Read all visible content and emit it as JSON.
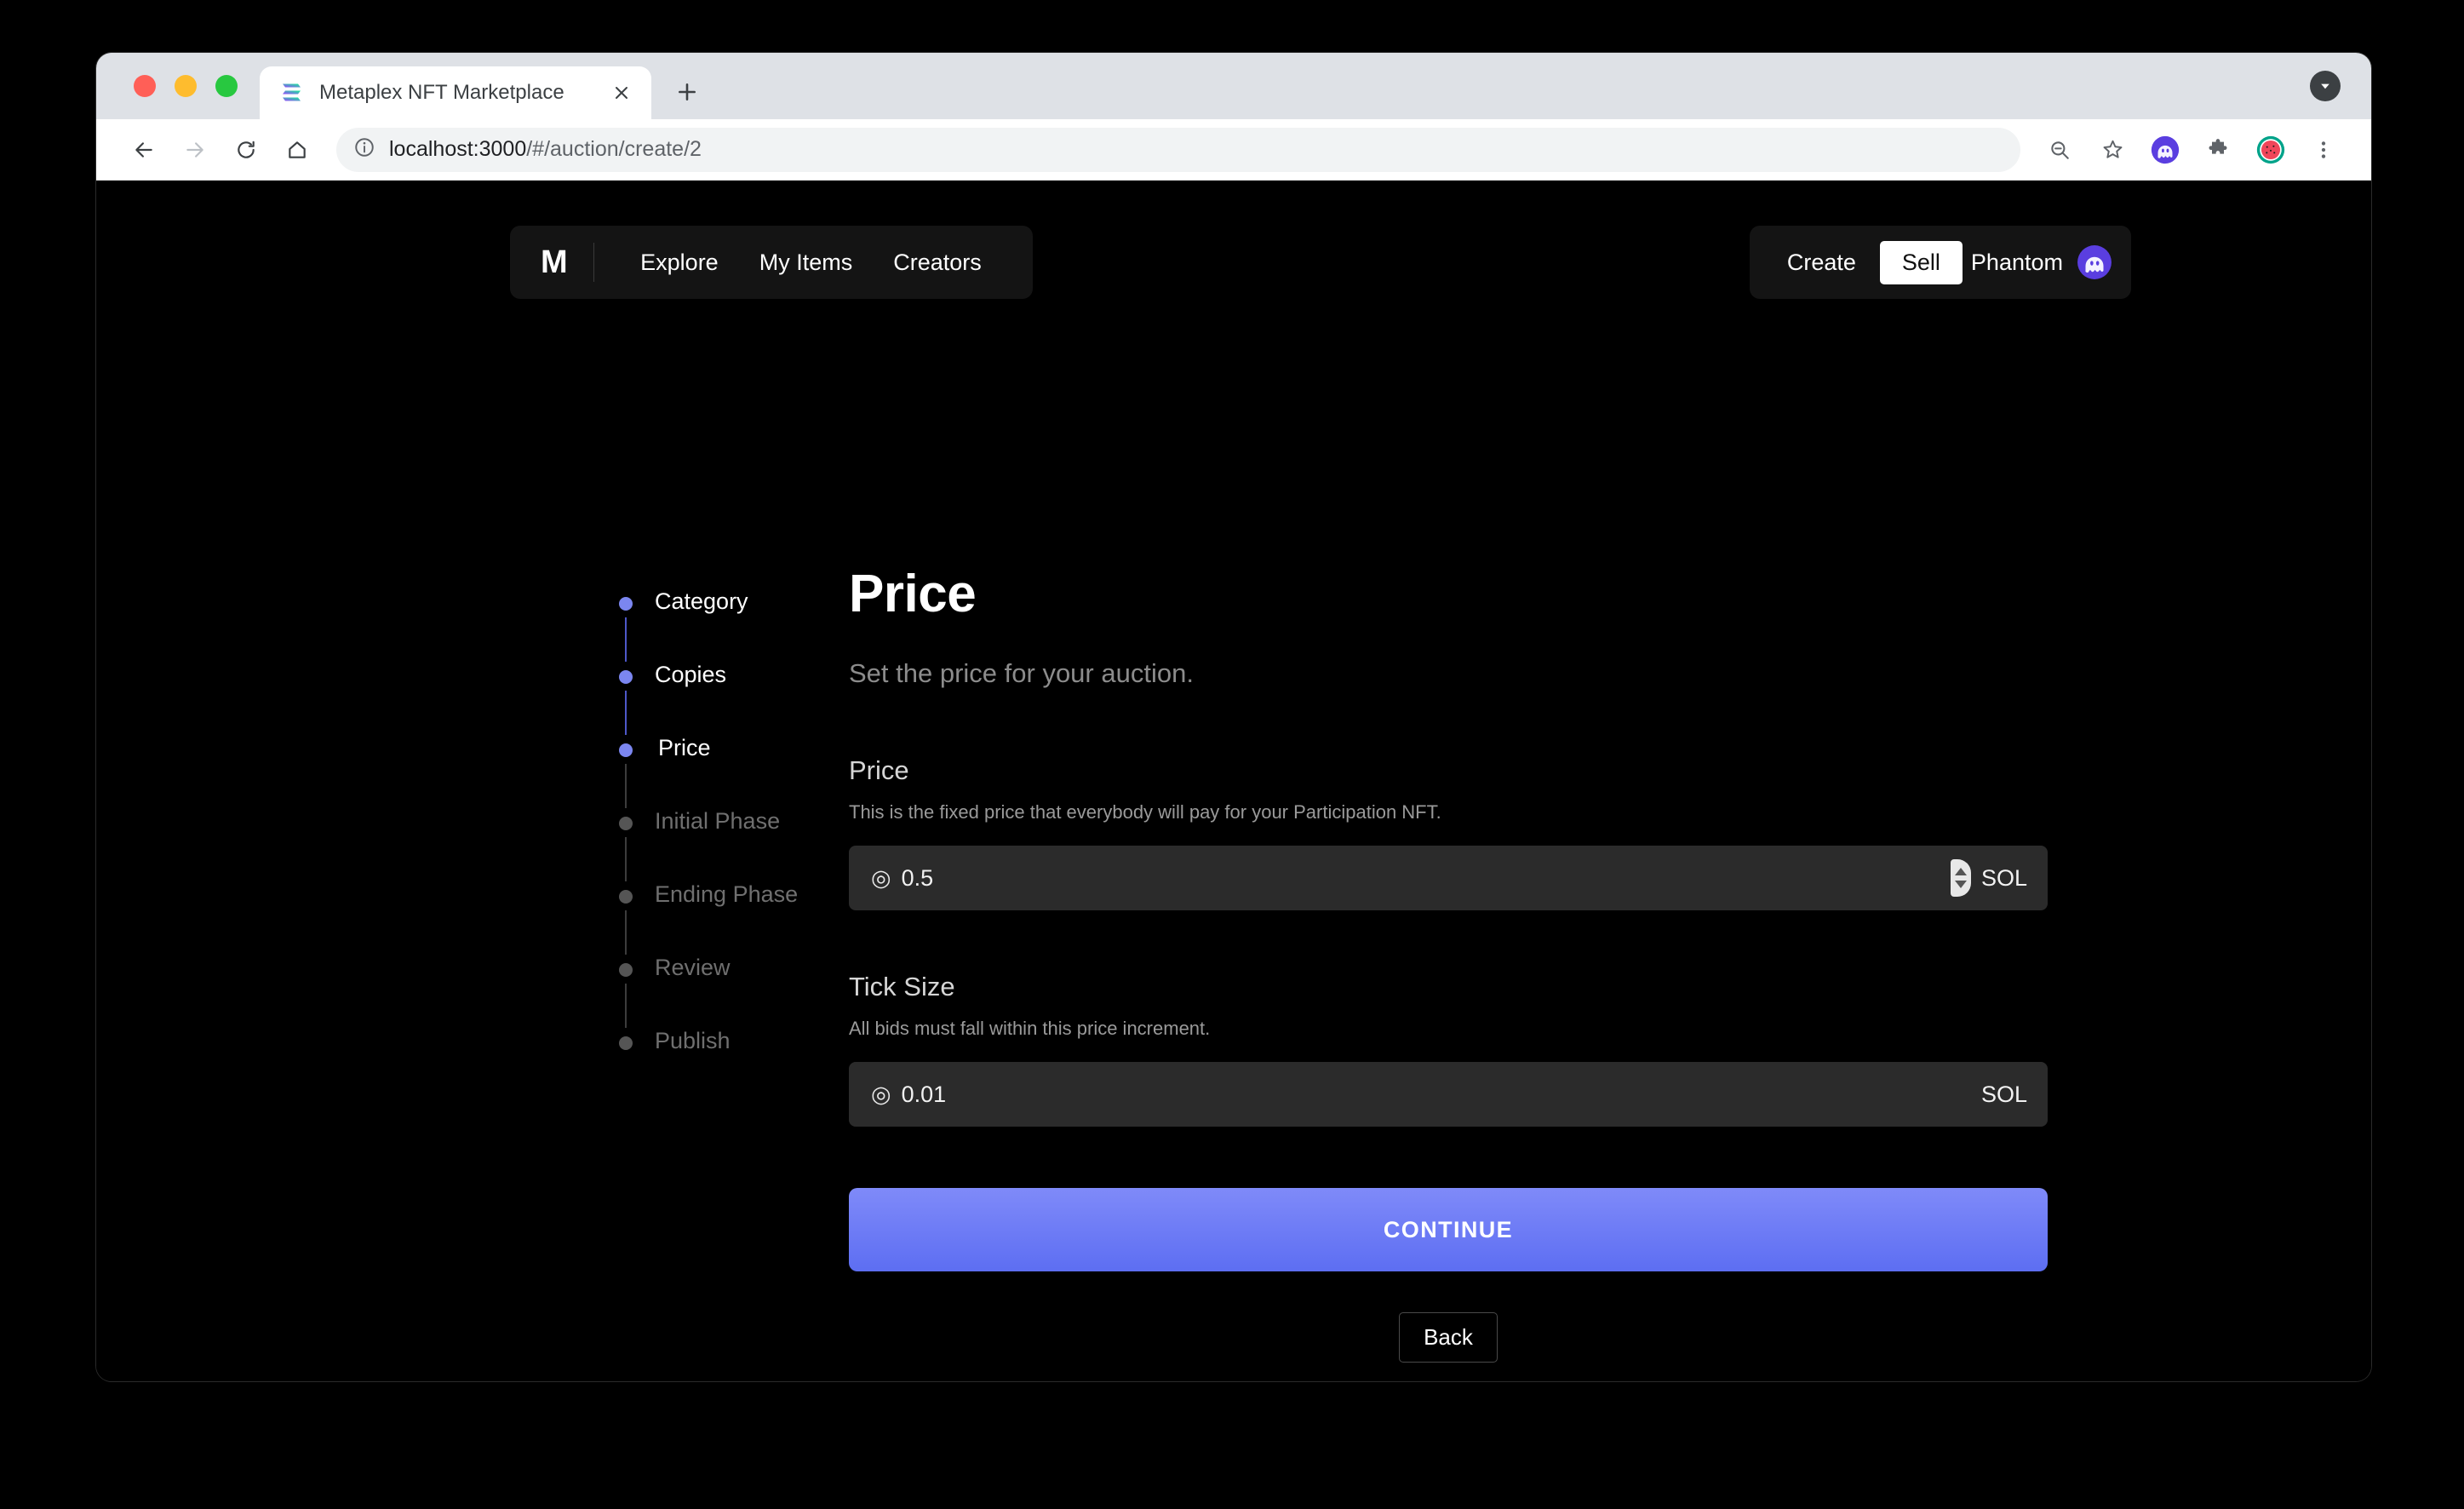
{
  "browser": {
    "tab": {
      "title": "Metaplex NFT Marketplace",
      "favicon_icon": "solana-logo-icon",
      "close_icon": "close-icon"
    },
    "new_tab_icon": "plus-icon",
    "tabstrip_chevron_icon": "chevron-down-icon",
    "toolbar": {
      "back_icon": "back-arrow-icon",
      "forward_icon": "forward-arrow-icon",
      "reload_icon": "reload-icon",
      "home_icon": "home-icon",
      "info_icon": "info-circle-icon",
      "url_host": "localhost:3000",
      "url_path": "/#/auction/create/2",
      "zoom_out_icon": "zoom-out-icon",
      "bookmark_icon": "star-icon",
      "phantom_icon": "phantom-wallet-icon",
      "extensions_icon": "puzzle-piece-icon",
      "profile_icon": "watermelon-avatar-icon",
      "menu_icon": "three-dot-menu-icon"
    }
  },
  "app": {
    "logo": "M",
    "nav": [
      {
        "label": "Explore"
      },
      {
        "label": "My Items"
      },
      {
        "label": "Creators"
      }
    ],
    "account": {
      "create_label": "Create",
      "sell_label": "Sell",
      "wallet_label": "Phantom",
      "wallet_avatar_icon": "phantom-ghost-icon"
    }
  },
  "stepper": {
    "steps": [
      {
        "label": "Category",
        "state": "done"
      },
      {
        "label": "Copies",
        "state": "done"
      },
      {
        "label": "Price",
        "state": "current"
      },
      {
        "label": "Initial Phase",
        "state": "upcoming"
      },
      {
        "label": "Ending Phase",
        "state": "upcoming"
      },
      {
        "label": "Review",
        "state": "upcoming"
      },
      {
        "label": "Publish",
        "state": "upcoming"
      }
    ]
  },
  "main": {
    "title": "Price",
    "subtitle": "Set the price for your auction.",
    "price_field": {
      "label": "Price",
      "help": "This is the fixed price that everybody will pay for your Participation NFT.",
      "prefix_symbol": "◎",
      "value": "0.5",
      "unit": "SOL",
      "spinner_icon": "number-spinner-icon"
    },
    "tick_field": {
      "label": "Tick Size",
      "help": "All bids must fall within this price increment.",
      "prefix_symbol": "◎",
      "value": "0.01",
      "unit": "SOL"
    },
    "continue_label": "CONTINUE",
    "back_label": "Back"
  },
  "colors": {
    "accent_blue": "#7b86f0",
    "button_gradient_top": "#7f8af9",
    "button_gradient_bottom": "#5d6ef2",
    "page_background": "#000000",
    "input_background": "#2b2b2b",
    "pill_background": "#141414"
  }
}
